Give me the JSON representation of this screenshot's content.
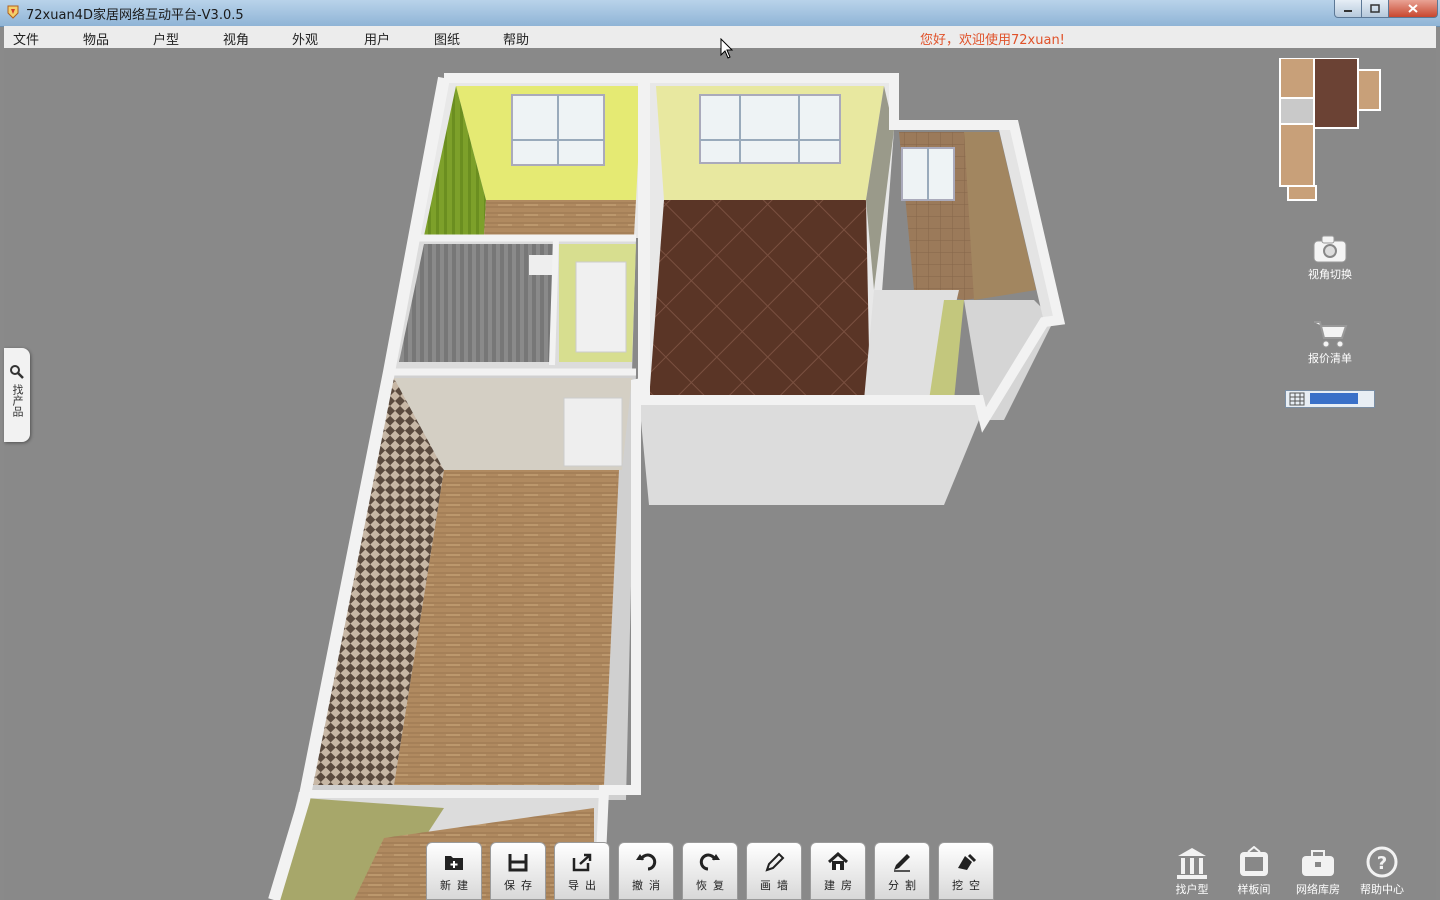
{
  "window": {
    "title": "72xuan4D家居网络互动平台-V3.0.5"
  },
  "menu": [
    {
      "label": "文件"
    },
    {
      "label": "物品"
    },
    {
      "label": "户型"
    },
    {
      "label": "视角"
    },
    {
      "label": "外观"
    },
    {
      "label": "用户"
    },
    {
      "label": "图纸"
    },
    {
      "label": "帮助"
    }
  ],
  "welcome": "您好，欢迎使用72xuan!",
  "left_tab": {
    "label": "找产品",
    "icon": "search-icon"
  },
  "right_panel": {
    "camera": {
      "label": "视角切换",
      "icon": "camera-icon"
    },
    "quote": {
      "label": "报价清单",
      "icon": "cart-icon"
    }
  },
  "toolbar": [
    {
      "label": "新建",
      "icon": "new-icon"
    },
    {
      "label": "保存",
      "icon": "save-icon"
    },
    {
      "label": "导出",
      "icon": "export-icon"
    },
    {
      "label": "撤消",
      "icon": "undo-icon"
    },
    {
      "label": "恢复",
      "icon": "redo-icon"
    },
    {
      "label": "画墙",
      "icon": "pencil-icon"
    },
    {
      "label": "建房",
      "icon": "house-icon"
    },
    {
      "label": "分割",
      "icon": "pen-icon"
    },
    {
      "label": "挖空",
      "icon": "dig-icon"
    }
  ],
  "bottom_links": [
    {
      "label": "找户型",
      "icon": "building-icon"
    },
    {
      "label": "样板间",
      "icon": "room-icon"
    },
    {
      "label": "网络库房",
      "icon": "toolbox-icon"
    },
    {
      "label": "帮助中心",
      "icon": "help-icon"
    }
  ],
  "colors": {
    "accent_red": "#e0522a",
    "viewport_bg": "#898989"
  }
}
